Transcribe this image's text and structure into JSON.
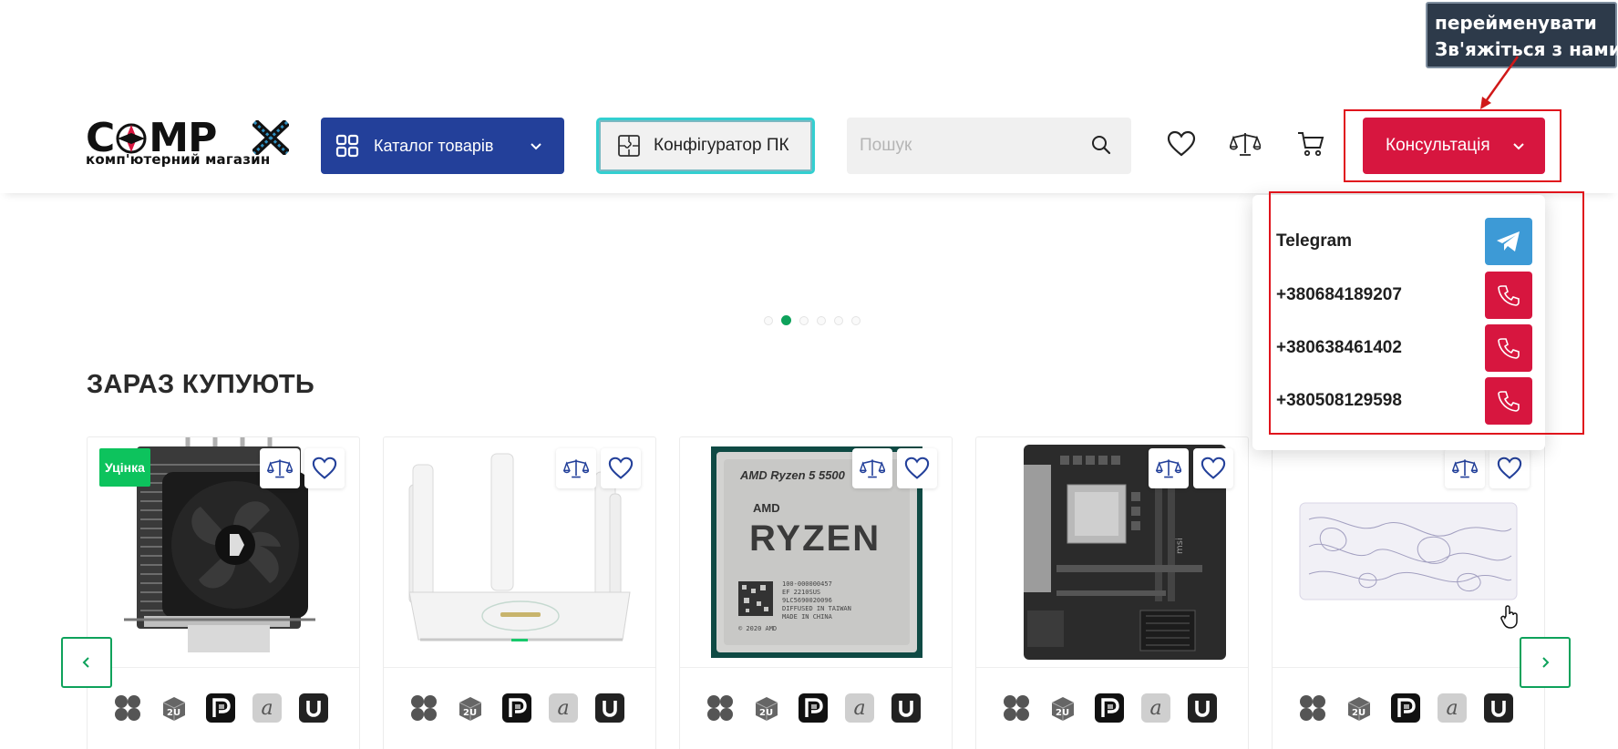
{
  "header": {
    "logo_text": "C MP",
    "logo_sub": "комп'ютерний магазин",
    "catalog_label": "Каталог товарів",
    "configurator_label": "Конфігуратор ПК",
    "search_placeholder": "Пошук",
    "consult_label": "Консультація"
  },
  "annotation": {
    "line1": "перейменувати",
    "line2": "Зв'яжіться з нами"
  },
  "contacts": [
    {
      "label": "Telegram",
      "icon": "telegram-icon"
    },
    {
      "label": "+380684189207",
      "icon": "phone-icon"
    },
    {
      "label": "+380638461402",
      "icon": "phone-icon"
    },
    {
      "label": "+380508129598",
      "icon": "phone-icon"
    }
  ],
  "slider": {
    "total": 6,
    "active": 2
  },
  "section": {
    "title": "ЗАРАЗ КУПУЮТЬ"
  },
  "products": [
    {
      "badge": "Уцінка",
      "image": "cpu-cooler",
      "image_text": ""
    },
    {
      "badge": "",
      "image": "wifi-router",
      "image_text": ""
    },
    {
      "badge": "",
      "image": "amd-ryzen-cpu",
      "image_text": "AMD Ryzen 5 5500",
      "image_brand": "RYZEN",
      "image_amd": "AMD",
      "image_lines": [
        "100-000000457",
        "EF 2210SUS",
        "9LC5690020096",
        "DIFFUSED IN TAIWAN",
        "MADE IN CHINA"
      ],
      "image_copy": "© 2020 AMD"
    },
    {
      "badge": "",
      "image": "motherboard",
      "image_text": ""
    },
    {
      "badge": "",
      "image": "mouse-pad",
      "image_text": ""
    }
  ],
  "stores": [
    "hotline-icon",
    "2u-icon",
    "prom-icon",
    "allo-icon",
    "u-icon"
  ],
  "colors": {
    "catalog": "#23409a",
    "consult": "#d7163f",
    "accent_green": "#0ea25b",
    "badge_green": "#0dc35d",
    "highlight_red": "#e0141c"
  }
}
